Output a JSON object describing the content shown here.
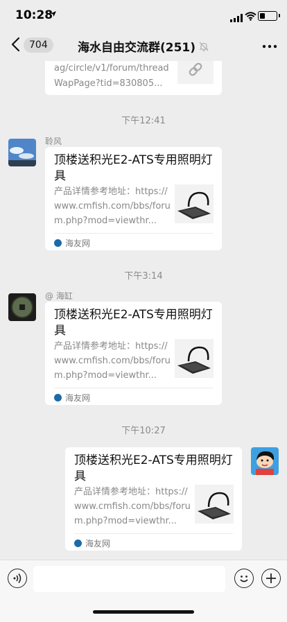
{
  "status_bar": {
    "time": "10:28"
  },
  "nav": {
    "unread_count": "704",
    "title": "海水自由交流群(251)"
  },
  "top_card": {
    "text": "ag/circle/v1/forum/threadWapPage?tid=830805..."
  },
  "messages": [
    {
      "timestamp": "下午12:41",
      "sender": "聆风",
      "title": "顶楼送积光E2-ATS专用照明灯具",
      "desc": "产品详情参考地址：https://www.cmfish.com/bbs/forum.php?mod=viewthr...",
      "source": "海友网"
    },
    {
      "timestamp": "下午3:14",
      "sender": "@ 海缸",
      "title": "顶楼送积光E2-ATS专用照明灯具",
      "desc": "产品详情参考地址：https://www.cmfish.com/bbs/forum.php?mod=viewthr...",
      "source": "海友网"
    },
    {
      "timestamp": "下午10:27",
      "title": "顶楼送积光E2-ATS专用照明灯具",
      "desc": "产品详情参考地址：https://www.cmfish.com/bbs/forum.php?mod=viewthr...",
      "source": "海友网"
    }
  ],
  "composer": {
    "value": ""
  },
  "icons": {
    "back": "chevron-left-icon",
    "more": "more-dots-icon",
    "mute": "bell-off-icon",
    "voice": "voice-icon",
    "emoji": "emoji-icon",
    "plus": "plus-icon",
    "link": "link-icon"
  },
  "colors": {
    "background": "#ededed",
    "card": "#ffffff",
    "timestamp": "#8a8a8a",
    "source_icon": "#1e6aa6"
  }
}
